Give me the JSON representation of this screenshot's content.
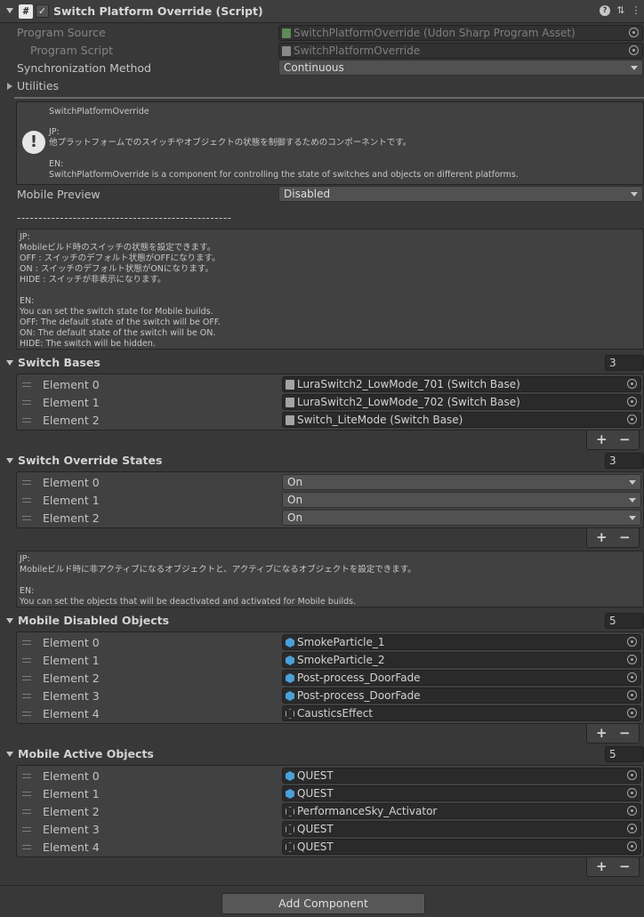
{
  "header": {
    "title": "Switch Platform Override (Script)",
    "script_glyph": "#",
    "check_glyph": "✓",
    "help_glyph": "?",
    "settings_glyph": "⇅",
    "menu_glyph": "⋮"
  },
  "fields": {
    "program_source_label": "Program Source",
    "program_source_value": "SwitchPlatformOverride (Udon Sharp Program Asset)",
    "program_script_label": "Program Script",
    "program_script_value": "SwitchPlatformOverride",
    "sync_label": "Synchronization Method",
    "sync_value": "Continuous",
    "utilities_label": "Utilities"
  },
  "helpbox": {
    "title": "SwitchPlatformOverride",
    "jp_tag": "JP:",
    "jp_text": "他プラットフォームでのスイッチやオブジェクトの状態を制御するためのコンポーネントです。",
    "en_tag": "EN:",
    "en_text": "SwitchPlatformOverride is a component for controlling the state of switches and objects on different platforms.",
    "icon_glyph": "!"
  },
  "mobile_preview": {
    "label": "Mobile Preview",
    "value": "Disabled"
  },
  "separator_text": "--------------------------------------------------",
  "note1": {
    "lines": [
      "JP:",
      "Mobileビルド時のスイッチの状態を設定できます。",
      "OFF : スイッチのデフォルト状態がOFFになります。",
      "ON : スイッチのデフォルト状態がONになります。",
      "HIDE : スイッチが非表示になります。",
      "",
      "EN:",
      "You can set the switch state for Mobile builds.",
      "OFF: The default state of the switch will be OFF.",
      "ON: The default state of the switch will be ON.",
      "HIDE: The switch will be hidden."
    ]
  },
  "switch_bases": {
    "title": "Switch Bases",
    "count": "3",
    "elements": [
      {
        "label": "Element 0",
        "value": "LuraSwitch2_LowMode_701 (Switch Base)"
      },
      {
        "label": "Element 1",
        "value": "LuraSwitch2_LowMode_702 (Switch Base)"
      },
      {
        "label": "Element 2",
        "value": "Switch_LiteMode (Switch Base)"
      }
    ]
  },
  "switch_override_states": {
    "title": "Switch Override States",
    "count": "3",
    "elements": [
      {
        "label": "Element 0",
        "value": "On"
      },
      {
        "label": "Element 1",
        "value": "On"
      },
      {
        "label": "Element 2",
        "value": "On"
      }
    ]
  },
  "note2": {
    "lines": [
      "JP:",
      "Mobileビルド時に非アクティブになるオブジェクトと、アクティブになるオブジェクトを設定できます。",
      "",
      "EN:",
      "You can set the objects that will be deactivated and activated for Mobile builds."
    ]
  },
  "mobile_disabled_objects": {
    "title": "Mobile Disabled Objects",
    "count": "5",
    "elements": [
      {
        "label": "Element 0",
        "value": "SmokeParticle_1",
        "icon": "prefab-icon"
      },
      {
        "label": "Element 1",
        "value": "SmokeParticle_2",
        "icon": "prefab-icon"
      },
      {
        "label": "Element 2",
        "value": "Post-process_DoorFade",
        "icon": "prefab-icon"
      },
      {
        "label": "Element 3",
        "value": "Post-process_DoorFade",
        "icon": "prefab-icon"
      },
      {
        "label": "Element 4",
        "value": "CausticsEffect",
        "icon": "gameobject-icon"
      }
    ]
  },
  "mobile_active_objects": {
    "title": "Mobile Active Objects",
    "count": "5",
    "elements": [
      {
        "label": "Element 0",
        "value": "QUEST",
        "icon": "prefab-icon"
      },
      {
        "label": "Element 1",
        "value": "QUEST",
        "icon": "prefab-icon"
      },
      {
        "label": "Element 2",
        "value": "PerformanceSky_Activator",
        "icon": "gameobject-icon"
      },
      {
        "label": "Element 3",
        "value": "QUEST",
        "icon": "gameobject-icon"
      },
      {
        "label": "Element 4",
        "value": "QUEST",
        "icon": "gameobject-icon"
      }
    ]
  },
  "list_buttons": {
    "plus": "+",
    "minus": "−"
  },
  "add_component_label": "Add Component"
}
